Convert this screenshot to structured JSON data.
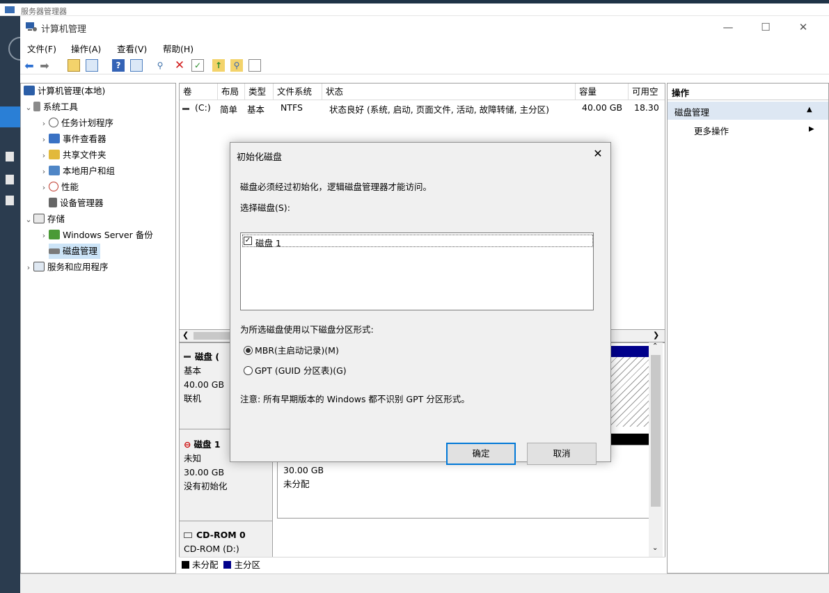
{
  "bg_window": {
    "title": "服务器管理器"
  },
  "window": {
    "title": "计算机管理",
    "minimize": "—",
    "maximize": "☐",
    "close": "✕"
  },
  "menu": [
    "文件(F)",
    "操作(A)",
    "查看(V)",
    "帮助(H)"
  ],
  "tree": {
    "root": "计算机管理(本地)",
    "system_tools": "系统工具",
    "task_scheduler": "任务计划程序",
    "event_viewer": "事件查看器",
    "shared_folders": "共享文件夹",
    "local_users": "本地用户和组",
    "performance": "性能",
    "device_manager": "设备管理器",
    "storage": "存储",
    "windows_backup": "Windows Server 备份",
    "disk_management": "磁盘管理",
    "services_apps": "服务和应用程序"
  },
  "volume_table": {
    "columns": [
      "卷",
      "布局",
      "类型",
      "文件系统",
      "状态",
      "容量",
      "可用空"
    ],
    "rows": [
      {
        "volume": "(C:)",
        "layout": "简单",
        "type": "基本",
        "fs": "NTFS",
        "status": "状态良好 (系统, 启动, 页面文件, 活动, 故障转储, 主分区)",
        "capacity": "40.00 GB",
        "free": "18.30"
      }
    ]
  },
  "disks": [
    {
      "name": "磁盘 (",
      "type": "基本",
      "size": "40.00 GB",
      "state": "联机"
    },
    {
      "name": "磁盘 1",
      "type": "未知",
      "size": "30.00 GB",
      "state": "没有初始化",
      "part_size": "30.00 GB",
      "part_state": "未分配"
    },
    {
      "name": "CD-ROM 0",
      "type": "CD-ROM (D:)"
    }
  ],
  "legend": {
    "unallocated": "未分配",
    "primary": "主分区"
  },
  "actions": {
    "header": "操作",
    "section": "磁盘管理",
    "more": "更多操作"
  },
  "dialog": {
    "title": "初始化磁盘",
    "close": "✕",
    "message": "磁盘必须经过初始化，逻辑磁盘管理器才能访问。",
    "select_label": "选择磁盘(S):",
    "disk_item": "磁盘 1",
    "style_label": "为所选磁盘使用以下磁盘分区形式:",
    "mbr": "MBR(主启动记录)(M)",
    "gpt": "GPT (GUID 分区表)(G)",
    "note": "注意: 所有早期版本的 Windows 都不识别 GPT 分区形式。",
    "ok": "确定",
    "cancel": "取消"
  },
  "colors": {
    "selection": "#cce4f7",
    "accent": "#0078d7",
    "primary_partition": "#00008b",
    "unallocated": "#000000"
  }
}
